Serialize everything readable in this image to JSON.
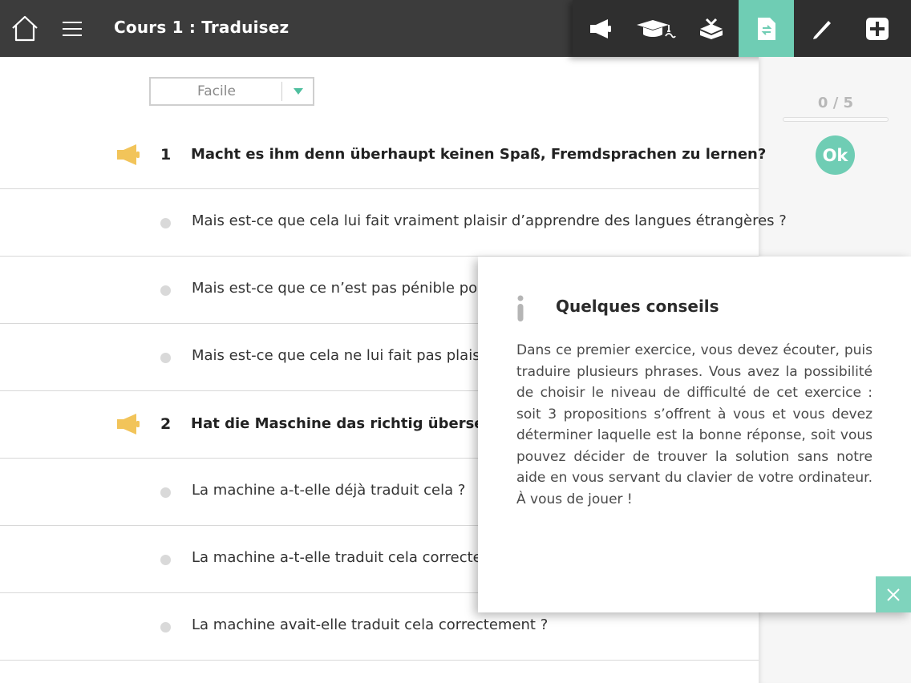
{
  "header": {
    "title": "Cours 1 : Traduisez"
  },
  "toolbar": {
    "tools": [
      {
        "icon": "megaphone-icon"
      },
      {
        "icon": "graduation-cap-icon"
      },
      {
        "icon": "inbox-tray-icon"
      },
      {
        "icon": "translate-document-icon",
        "active": true
      },
      {
        "icon": "pencil-icon"
      },
      {
        "icon": "add-icon"
      }
    ]
  },
  "difficulty": {
    "selected": "Facile"
  },
  "score": {
    "text": "0 / 5",
    "ok_label": "Ok"
  },
  "questions": [
    {
      "number": "1",
      "text": "Macht es ihm denn überhaupt keinen Spaß, Fremdsprachen zu lernen?",
      "options": [
        "Mais est-ce que cela lui fait vraiment plaisir d’apprendre des langues étrangères ?",
        "Mais est-ce que ce n’est pas pénible pour lui d",
        "Mais est-ce que cela ne lui fait pas plaisir d’ap"
      ]
    },
    {
      "number": "2",
      "text": "Hat die Maschine das richtig übersetzt?",
      "options": [
        "La machine a-t-elle déjà traduit cela ?",
        "La machine a-t-elle traduit cela correctement",
        "La machine avait-elle traduit cela correctement ?"
      ]
    }
  ],
  "tips": {
    "title": "Quelques conseils",
    "body": "Dans ce premier exercice, vous devez écouter, puis traduire plusieurs phrases. Vous avez la possibilité de choisir le niveau de difficulté de cet exercice : soit 3 propositions s’offrent à vous et vous devez déterminer laquelle est la bonne réponse, soit vous pouvez décider de trouver la solution sans notre aide en vous servant du clavier de votre ordinateur. À vous de jouer !"
  },
  "colors": {
    "accent": "#6fcdb4",
    "topbar": "#3c3c3c",
    "speaker": "#f2c45a"
  }
}
